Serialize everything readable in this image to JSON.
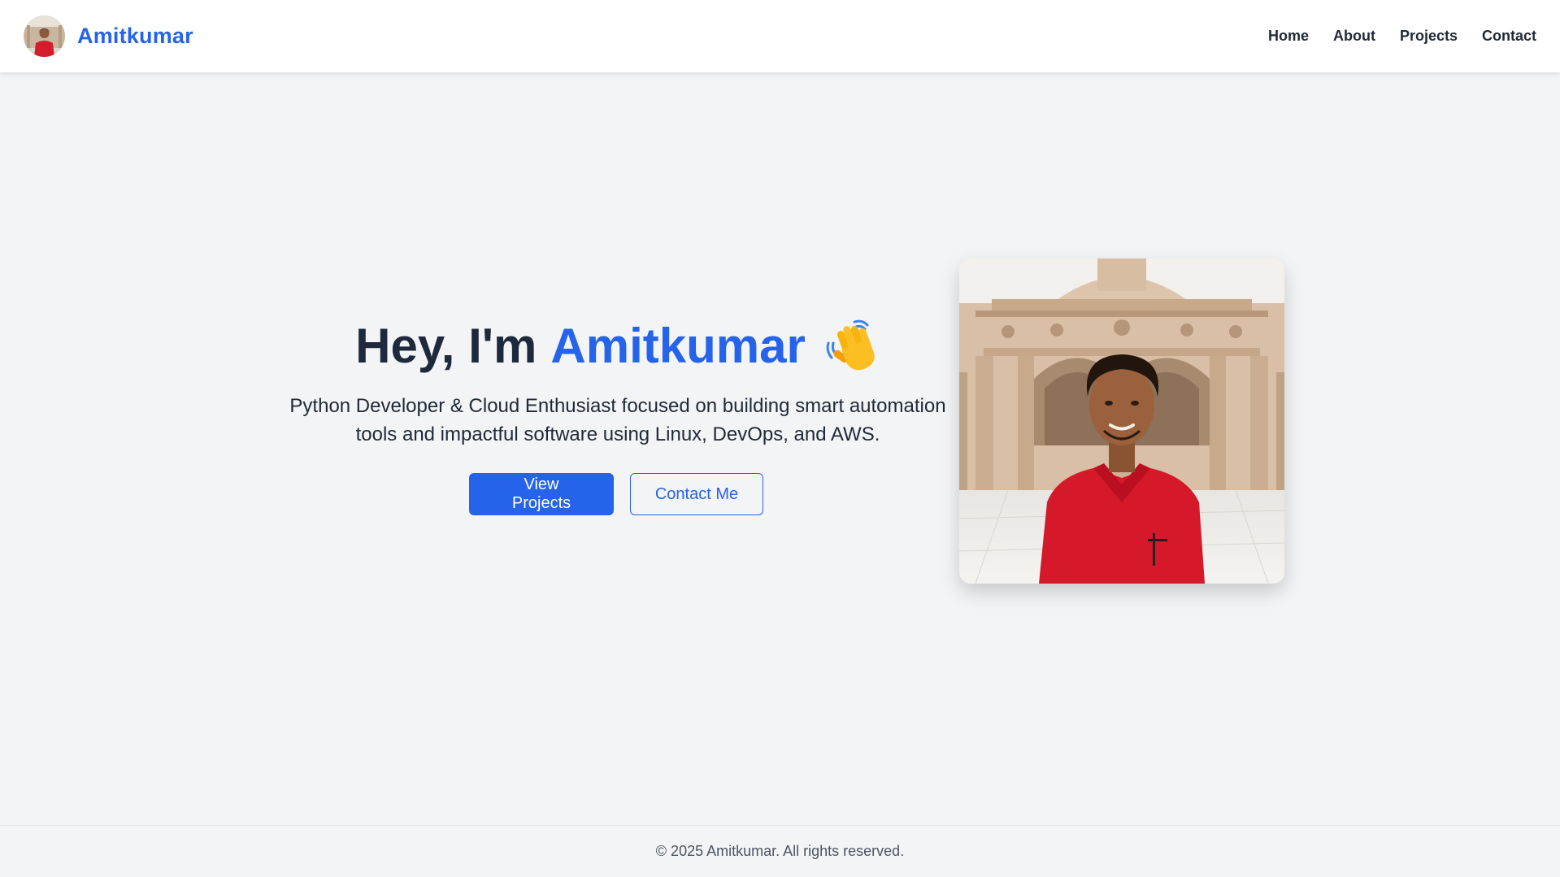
{
  "navbar": {
    "brand_name": "Amitkumar",
    "brand_avatar_icon": "profile-avatar",
    "links": [
      {
        "label": "Home"
      },
      {
        "label": "About"
      },
      {
        "label": "Projects"
      },
      {
        "label": "Contact"
      }
    ]
  },
  "hero": {
    "greeting": "Hey, I'm",
    "name": "Amitkumar",
    "wave_icon": "waving-hand-icon",
    "subtitle": "Python Developer & Cloud Enthusiast focused on building smart automation tools and impactful software using Linux, DevOps, and AWS.",
    "primary_button": "View Projects",
    "secondary_button": "Contact Me",
    "photo_icon": "profile-photo"
  },
  "footer": {
    "copyright": "© 2025 Amitkumar. All rights reserved."
  },
  "colors": {
    "accent": "#2563eb",
    "heading": "#1e293b",
    "background": "#f3f4f6",
    "navbar": "#ffffff",
    "footer_text": "#4b5563"
  }
}
